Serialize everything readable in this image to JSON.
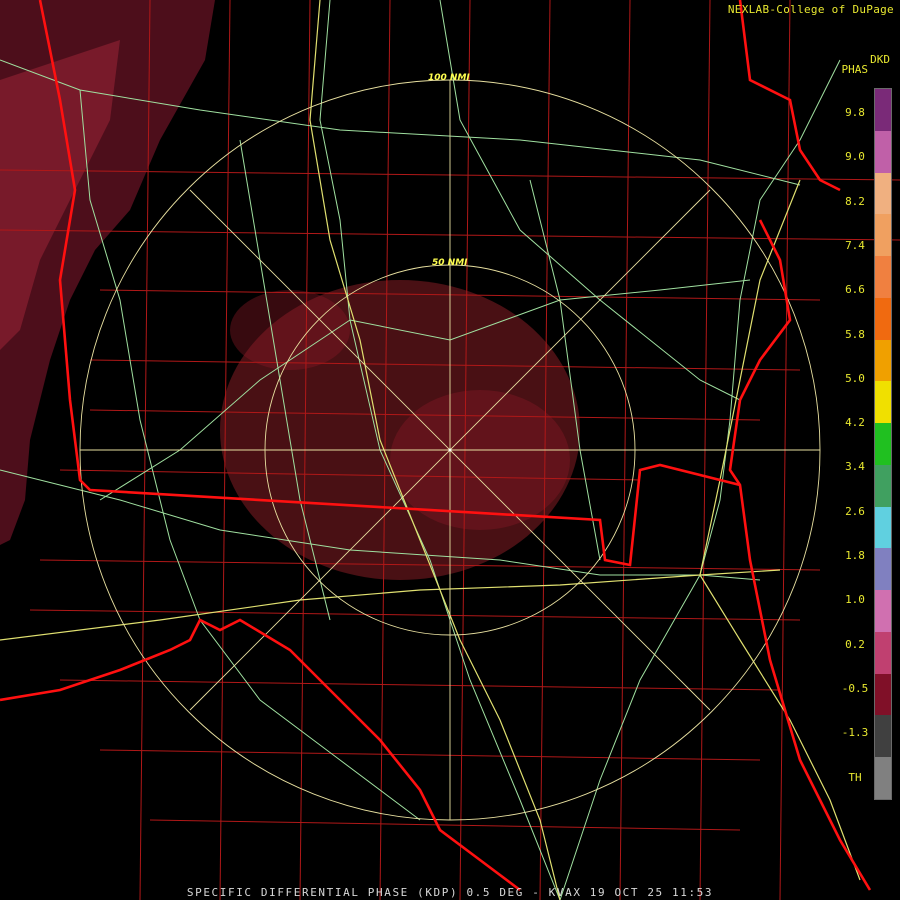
{
  "credit": "NEXLAB-College of DuPage",
  "legend": {
    "units_line1": "DKD",
    "units_line2": "PHAS",
    "ticks": [
      "9.8",
      "9.0",
      "8.2",
      "7.4",
      "6.6",
      "5.8",
      "5.0",
      "4.2",
      "3.4",
      "2.6",
      "1.8",
      "1.0",
      "0.2",
      "-0.5",
      "-1.3",
      "TH"
    ],
    "colors": [
      "#7a2a78",
      "#c060a8",
      "#f0b080",
      "#f0a060",
      "#f08040",
      "#f06a10",
      "#f0a000",
      "#f0e000",
      "#20c020",
      "#40a060",
      "#60d0e0",
      "#8080c0",
      "#d070b0",
      "#c04070",
      "#801028",
      "#404040",
      "#808080"
    ]
  },
  "range_rings": {
    "ring_100": "100 NMI",
    "ring_50": "50 NMI"
  },
  "footer": "SPECIFIC DIFFERENTIAL PHASE (KDP) 0.5 DEG - KVAX 19 OCT 25 11:53",
  "colors": {
    "state_line": "#ff1010",
    "county_line": "#b01818",
    "road": "#a0e0a0",
    "interstate": "#e0e070",
    "ring": "#e8e0a0"
  }
}
